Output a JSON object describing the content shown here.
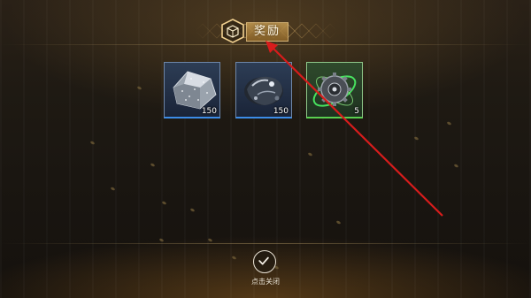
{
  "header": {
    "title": "奖励",
    "title_icon": "box-icon"
  },
  "rewards": [
    {
      "item_icon": "silver-ore-icon",
      "quantity": "150",
      "rarity": "blue",
      "color": "#3c8ce8"
    },
    {
      "item_icon": "dark-mineral-icon",
      "quantity": "150",
      "rarity": "blue",
      "color": "#3c8ce8"
    },
    {
      "item_icon": "gear-core-icon",
      "quantity": "5",
      "rarity": "green",
      "color": "#59d04f"
    }
  ],
  "footer": {
    "close_label": "点击关闭",
    "close_icon": "checkmark-icon"
  },
  "colors": {
    "accent_gold": "#c89a50",
    "annotation_arrow": "#d81c1c"
  }
}
